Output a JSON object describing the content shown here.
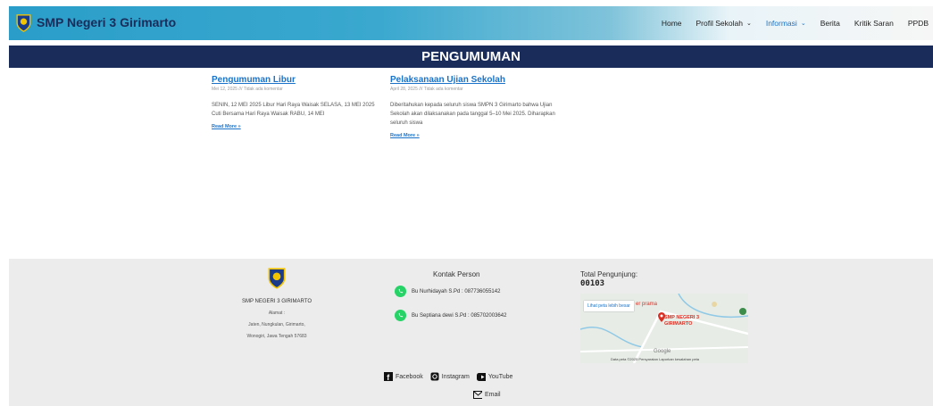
{
  "header": {
    "site_title": "SMP Negeri 3 Girimarto",
    "nav": [
      {
        "label": "Home",
        "dropdown": false
      },
      {
        "label": "Profil Sekolah",
        "dropdown": true
      },
      {
        "label": "Informasi",
        "dropdown": true,
        "active": true
      },
      {
        "label": "Berita",
        "dropdown": false
      },
      {
        "label": "Kritik Saran",
        "dropdown": false
      },
      {
        "label": "PPDB",
        "dropdown": false
      }
    ]
  },
  "page_title": "PENGUMUMAN",
  "posts": [
    {
      "title": "Pengumuman Libur",
      "meta": "Mei 12, 2025 /// Tidak ada komentar",
      "excerpt": "SENIN, 12 MEI 2025 Libur Hari Raya Waisak SELASA, 13 MEI 2025 Cuti Bersama Hari Raya Waisak RABU, 14 MEI",
      "read_more": "Read More »"
    },
    {
      "title": "Pelaksanaan Ujian Sekolah",
      "meta": "April 28, 2025 /// Tidak ada komentar",
      "excerpt": "Diberitahukan kepada seluruh siswa SMPN 3 Girimarto bahwa Ujian Sekolah akan dilaksanakan pada tanggal 5–10 Mei 2025. Diharapkan seluruh siswa",
      "read_more": "Read More »"
    }
  ],
  "footer": {
    "school_name": "SMP NEGERI 3 GIRIMARTO",
    "address_label": "Alamat :",
    "address_line1": "Jaten, Nungkulan, Girimarto,",
    "address_line2": "Wonogiri, Jawa Tengah 57683",
    "contact_title": "Kontak Person",
    "contacts": [
      "Bu Nurhidayah S.Pd : 087736055142",
      "Bu Septiana dewi S.Pd : 085702003642"
    ],
    "visitors_label": "Total Pengunjung:",
    "visitors_count": "00103",
    "map": {
      "view_larger": "Lihat peta lebih besar",
      "place_label": "SMP NEGERI 3 GIRIMARTO",
      "nearby": "er prama",
      "attribution": "Data peta ©2025   Persyaratan   Laporkan kesalahan peta",
      "google": "Google"
    },
    "social": [
      {
        "label": "Facebook",
        "icon": "facebook-icon"
      },
      {
        "label": "Instagram",
        "icon": "instagram-icon"
      },
      {
        "label": "YouTube",
        "icon": "youtube-icon"
      }
    ],
    "email_label": "Email"
  }
}
